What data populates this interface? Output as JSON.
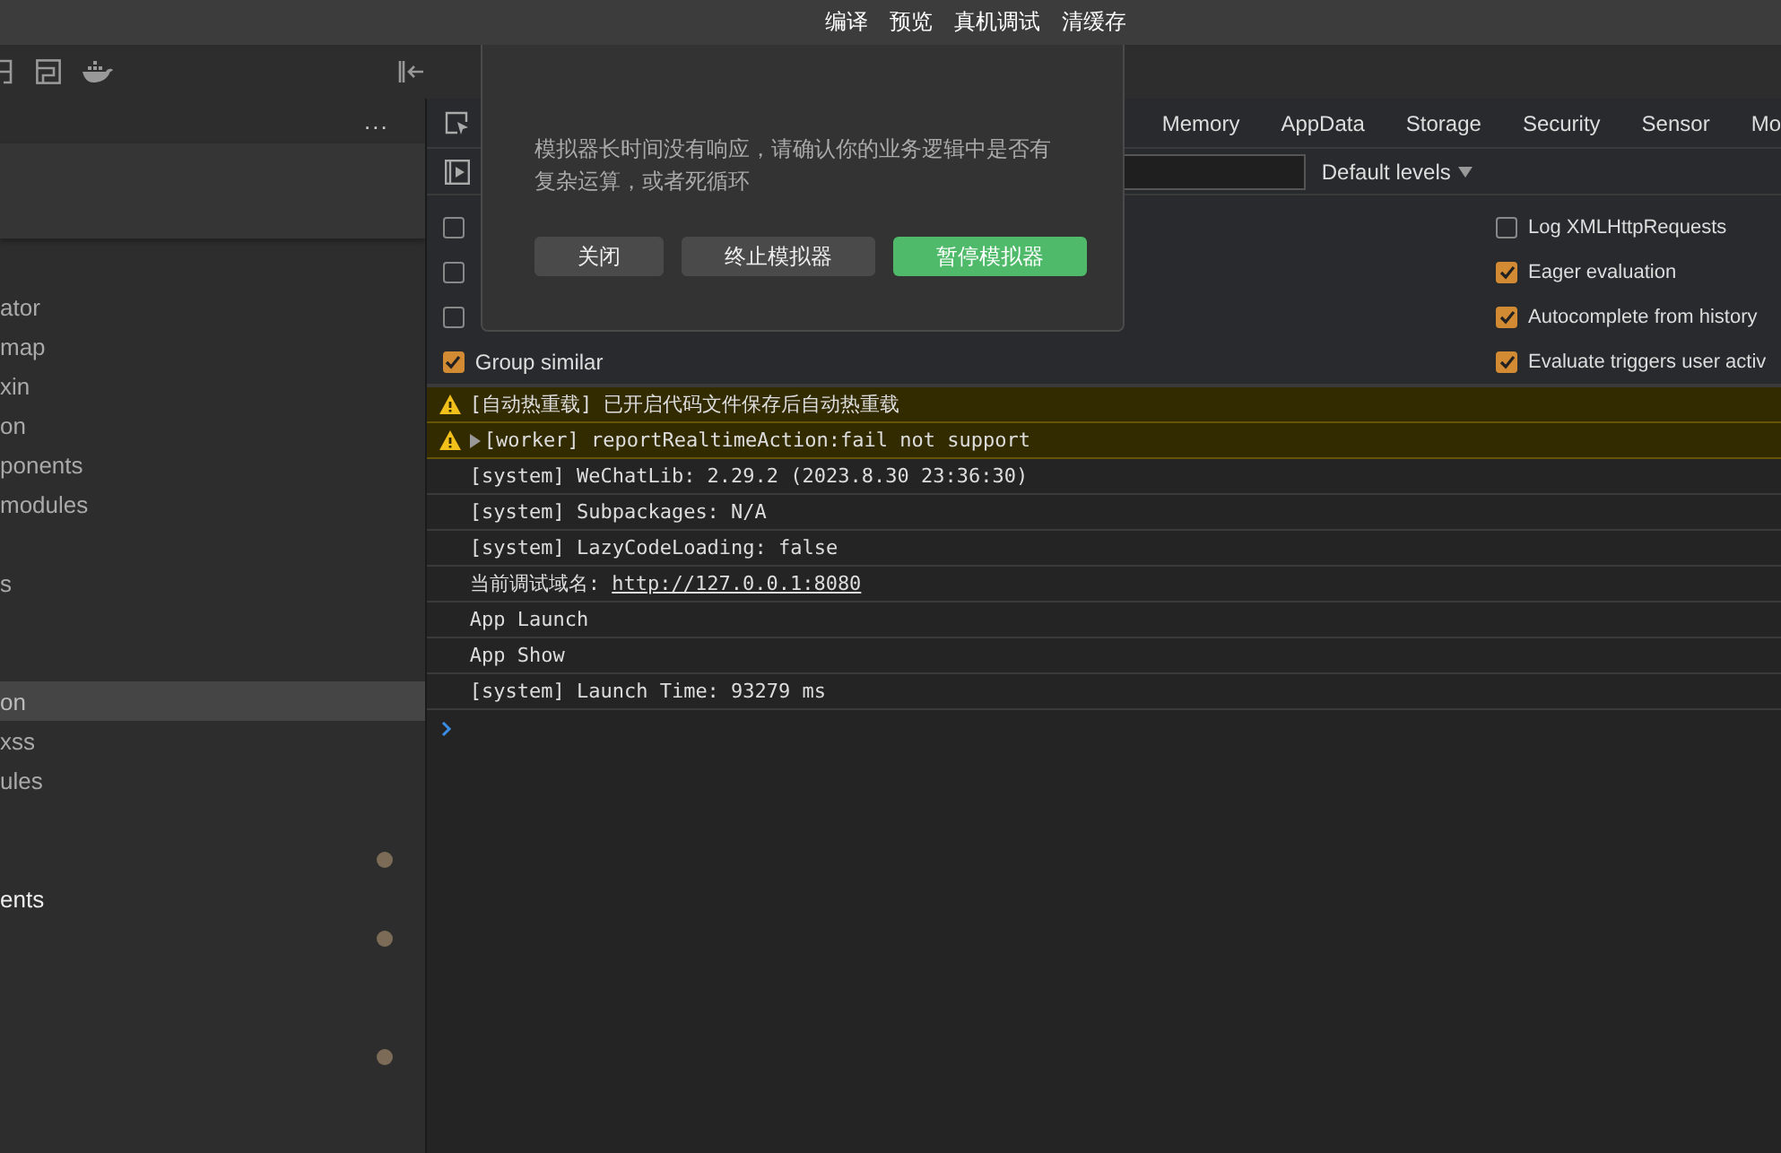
{
  "menu_bar": {
    "items": [
      "编译",
      "预览",
      "真机调试",
      "清缓存"
    ]
  },
  "sidebar": {
    "more": "...",
    "items": [
      {
        "kind": "file",
        "label": "ator",
        "selected": false,
        "modified": false
      },
      {
        "kind": "file",
        "label": "map",
        "selected": false,
        "modified": false
      },
      {
        "kind": "file",
        "label": "xin",
        "selected": false,
        "modified": false
      },
      {
        "kind": "file",
        "label": "on",
        "selected": false,
        "modified": false
      },
      {
        "kind": "file",
        "label": "ponents",
        "selected": false,
        "modified": false
      },
      {
        "kind": "file",
        "label": "modules",
        "selected": false,
        "modified": false
      },
      {
        "kind": "blank"
      },
      {
        "kind": "file",
        "label": "s",
        "selected": false,
        "modified": false
      },
      {
        "kind": "blank"
      },
      {
        "kind": "blank"
      },
      {
        "kind": "file",
        "label": "on",
        "selected": true,
        "modified": false
      },
      {
        "kind": "file",
        "label": "xss",
        "selected": false,
        "modified": false
      },
      {
        "kind": "file",
        "label": "ules",
        "selected": false,
        "modified": false
      },
      {
        "kind": "blank"
      },
      {
        "kind": "blank",
        "modified": true
      },
      {
        "kind": "folder",
        "label": "ents",
        "selected": false,
        "modified": false
      },
      {
        "kind": "blank",
        "modified": true
      },
      {
        "kind": "blank"
      },
      {
        "kind": "blank"
      },
      {
        "kind": "blank",
        "modified": true
      }
    ]
  },
  "devtools": {
    "tabs": [
      "Memory",
      "AppData",
      "Storage",
      "Security",
      "Sensor",
      "Mo"
    ],
    "levels": "Default levels",
    "settings_left": [
      {
        "checked": false
      },
      {
        "checked": false
      },
      {
        "checked": false
      },
      {
        "label": "Group similar",
        "checked": true
      }
    ],
    "settings_right": [
      {
        "label": "Log XMLHttpRequests",
        "checked": false
      },
      {
        "label": "Eager evaluation",
        "checked": true
      },
      {
        "label": "Autocomplete from history",
        "checked": true
      },
      {
        "label": "Evaluate triggers user activ",
        "checked": true
      }
    ],
    "console": [
      {
        "kind": "warning",
        "expandable": false,
        "text": "[自动热重载] 已开启代码文件保存后自动热重载"
      },
      {
        "kind": "warning",
        "expandable": true,
        "text": "[worker] reportRealtimeAction:fail not support"
      },
      {
        "kind": "log",
        "expandable": false,
        "text": "[system] WeChatLib: 2.29.2 (2023.8.30 23:36:30)"
      },
      {
        "kind": "log",
        "expandable": false,
        "text": "[system] Subpackages: N/A"
      },
      {
        "kind": "log",
        "expandable": false,
        "text": "[system] LazyCodeLoading: false"
      },
      {
        "kind": "log",
        "expandable": false,
        "text": "当前调试域名: ",
        "link": "http://127.0.0.1:8080"
      },
      {
        "kind": "log",
        "expandable": false,
        "text": "App Launch"
      },
      {
        "kind": "log",
        "expandable": false,
        "text": "App Show"
      },
      {
        "kind": "log",
        "expandable": false,
        "text": "[system] Launch Time: 93279 ms"
      }
    ]
  },
  "dialog": {
    "message": "模拟器长时间没有响应，请确认你的业务逻辑中是否有复杂运算，或者死循环",
    "buttons": [
      {
        "label": "关闭",
        "kind": "secondary"
      },
      {
        "label": "终止模拟器",
        "kind": "secondary"
      },
      {
        "label": "暂停模拟器",
        "kind": "primary"
      }
    ]
  }
}
